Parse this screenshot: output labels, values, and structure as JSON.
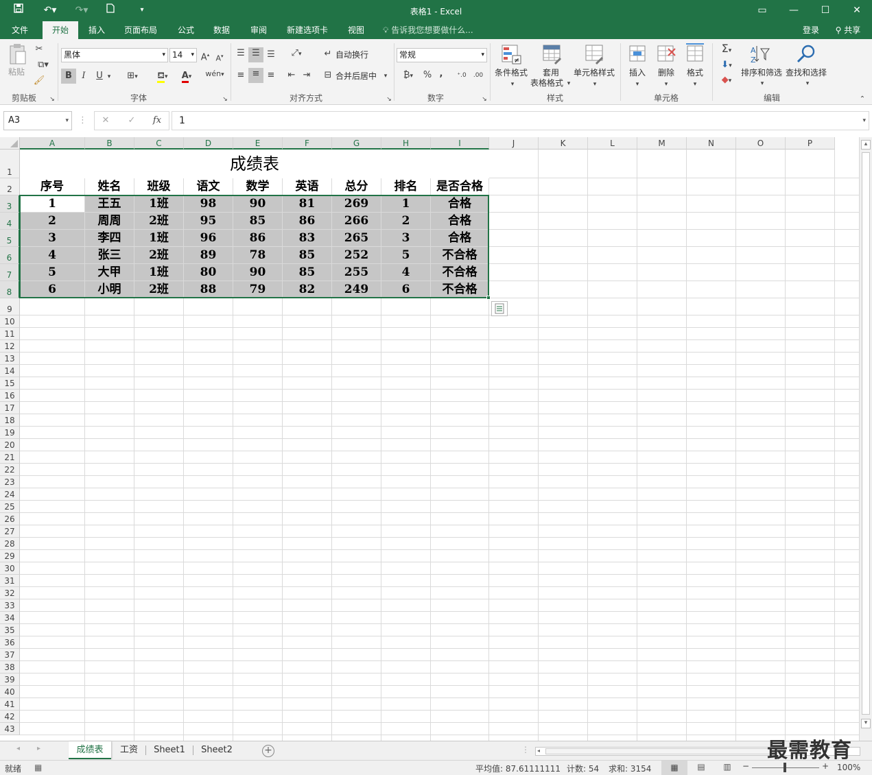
{
  "titlebar": {
    "title": "表格1 - Excel"
  },
  "ribbon_tabs": [
    {
      "label": "文件"
    },
    {
      "label": "开始"
    },
    {
      "label": "插入"
    },
    {
      "label": "页面布局"
    },
    {
      "label": "公式"
    },
    {
      "label": "数据"
    },
    {
      "label": "审阅"
    },
    {
      "label": "新建选项卡"
    },
    {
      "label": "视图"
    }
  ],
  "tell_me": "告诉我您想要做什么...",
  "account": {
    "login": "登录",
    "share": "共享"
  },
  "ribbon": {
    "clipboard": {
      "paste": "粘贴",
      "group": "剪贴板"
    },
    "font": {
      "family": "黑体",
      "size": "14",
      "group": "字体",
      "bold": "B",
      "italic": "I",
      "underline": "U"
    },
    "alignment": {
      "wrap": "自动换行",
      "merge": "合并后居中",
      "group": "对齐方式"
    },
    "number": {
      "format": "常规",
      "percent": "%",
      "comma": ",",
      "group": "数字"
    },
    "styles": {
      "conditional": "条件格式",
      "table_format_1": "套用",
      "table_format_2": "表格格式",
      "cell_style": "单元格样式",
      "group": "样式"
    },
    "cells": {
      "insert": "插入",
      "delete": "删除",
      "format": "格式",
      "group": "单元格"
    },
    "editing": {
      "sort": "排序和筛选",
      "find": "查找和选择",
      "group": "编辑"
    }
  },
  "formula_bar": {
    "namebox": "A3",
    "value": "1",
    "fx": "fx"
  },
  "columns": [
    "A",
    "B",
    "C",
    "D",
    "E",
    "F",
    "G",
    "H",
    "I",
    "J",
    "K",
    "L",
    "M",
    "N",
    "O",
    "P"
  ],
  "rows": [
    "1",
    "2",
    "3",
    "4",
    "5",
    "6",
    "7",
    "8",
    "9",
    "10",
    "11",
    "12",
    "13",
    "14",
    "15",
    "16",
    "17",
    "18",
    "19",
    "20",
    "21",
    "22",
    "23",
    "24",
    "25",
    "26",
    "27",
    "28",
    "29",
    "30",
    "31",
    "32",
    "33",
    "34",
    "35",
    "36",
    "37",
    "38",
    "39",
    "40",
    "41",
    "42",
    "43"
  ],
  "sheet": {
    "title": "成绩表",
    "headers": [
      "序号",
      "姓名",
      "班级",
      "语文",
      "数学",
      "英语",
      "总分",
      "排名",
      "是否合格"
    ],
    "data": [
      [
        "1",
        "王五",
        "1班",
        "98",
        "90",
        "81",
        "269",
        "1",
        "合格"
      ],
      [
        "2",
        "周周",
        "2班",
        "95",
        "85",
        "86",
        "266",
        "2",
        "合格"
      ],
      [
        "3",
        "李四",
        "1班",
        "96",
        "86",
        "83",
        "265",
        "3",
        "合格"
      ],
      [
        "4",
        "张三",
        "2班",
        "89",
        "78",
        "85",
        "252",
        "5",
        "不合格"
      ],
      [
        "5",
        "大甲",
        "1班",
        "80",
        "90",
        "85",
        "255",
        "4",
        "不合格"
      ],
      [
        "6",
        "小明",
        "2班",
        "88",
        "79",
        "82",
        "249",
        "6",
        "不合格"
      ]
    ]
  },
  "sheet_tabs": [
    {
      "label": "成绩表"
    },
    {
      "label": "工资"
    },
    {
      "label": "Sheet1"
    },
    {
      "label": "Sheet2"
    }
  ],
  "status": {
    "ready": "就绪",
    "average": "平均值: 87.61111111",
    "count": "计数: 54",
    "sum": "求和: 3154",
    "zoom": "100%"
  },
  "watermark": "最需教育",
  "colors": {
    "accent": "#217346",
    "selection": "#c6c6c6"
  }
}
